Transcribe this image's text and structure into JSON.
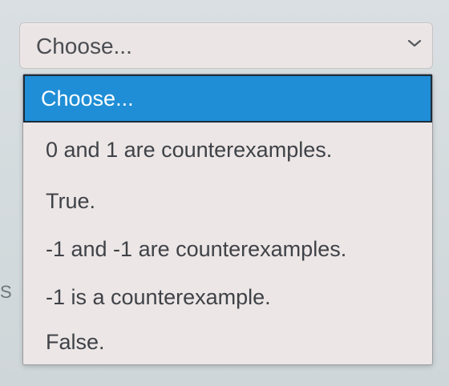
{
  "select": {
    "value": "Choose...",
    "icon": "chevron-down-icon",
    "options": [
      {
        "label": "Choose...",
        "selected": true
      },
      {
        "label": "0 and 1 are counterexamples.",
        "selected": false
      },
      {
        "label": "True.",
        "selected": false
      },
      {
        "label": "-1 and -1 are counterexamples.",
        "selected": false
      },
      {
        "label": "-1 is a counterexample.",
        "selected": false
      },
      {
        "label": "False.",
        "selected": false
      }
    ]
  },
  "background": {
    "side_glyph": "S"
  },
  "colors": {
    "selected_bg": "#1f8ed6",
    "selected_text": "#ffffff",
    "menu_bg": "#ece6e6",
    "text": "#3f4247"
  }
}
